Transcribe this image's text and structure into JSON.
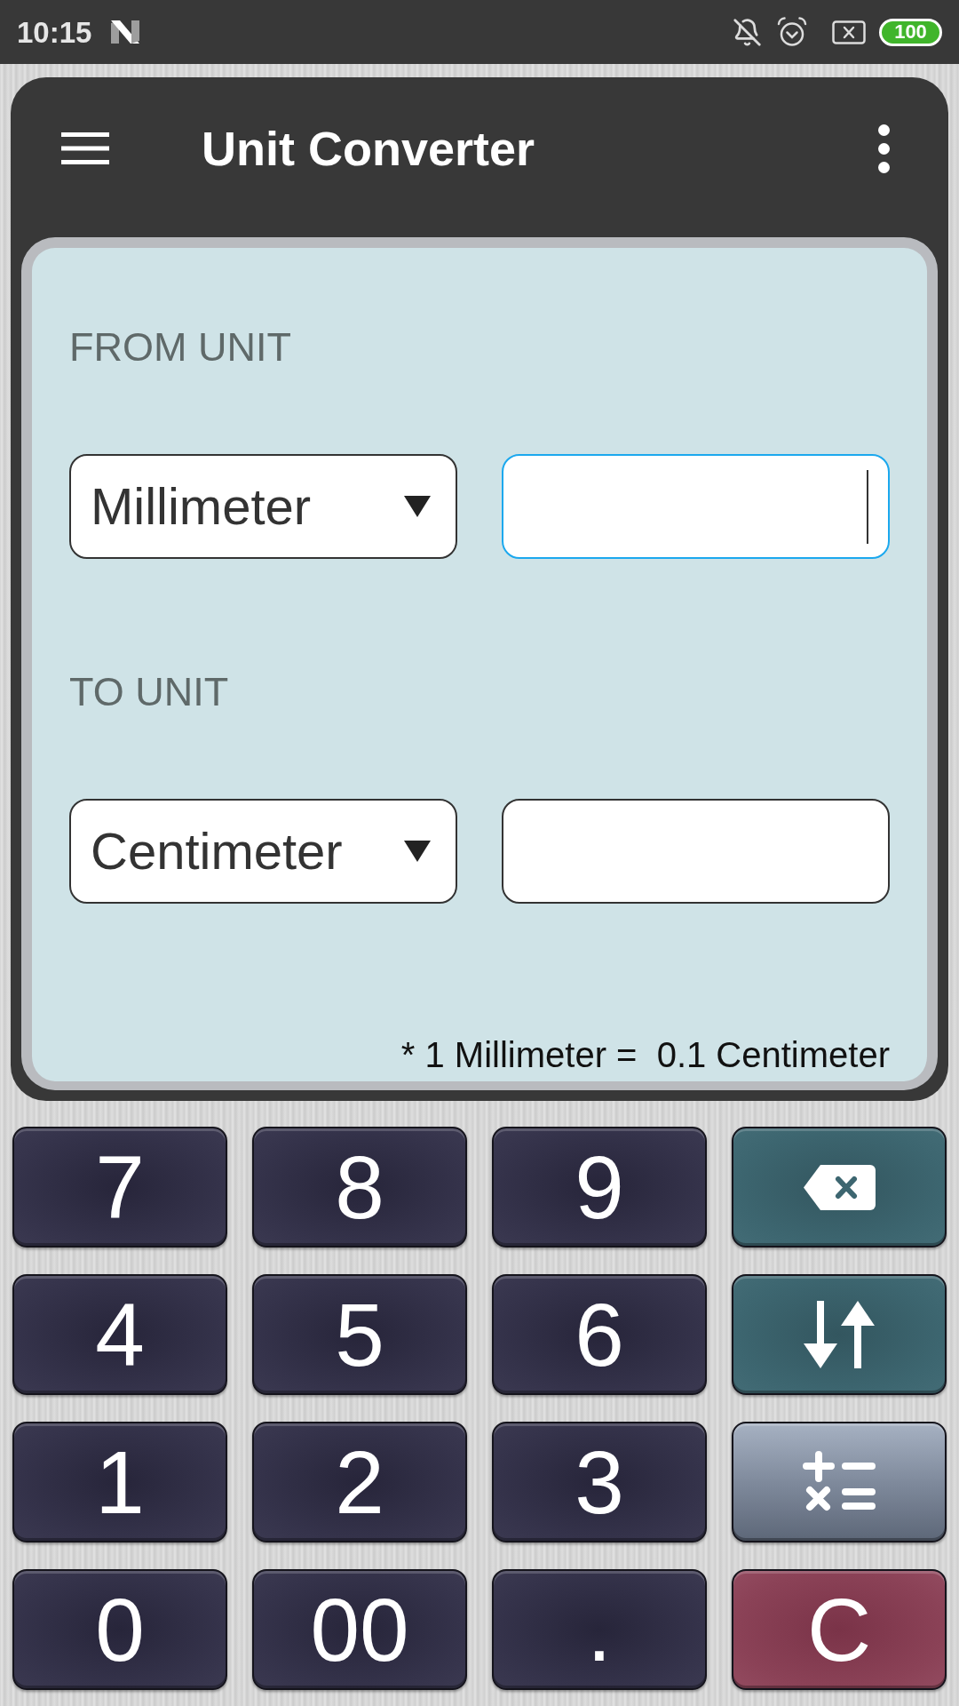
{
  "status_bar": {
    "time": "10:15",
    "battery": "100"
  },
  "app_bar": {
    "title": "Unit Converter"
  },
  "converter": {
    "sections": [
      {
        "label": "FROM UNIT",
        "unit": "Millimeter",
        "focused": true
      },
      {
        "label": "TO UNIT",
        "unit": "Centimeter",
        "focused": false
      }
    ],
    "note": "* 1 Millimeter =  0.1 Centimeter"
  },
  "keypad": [
    {
      "kind": "digit",
      "label": "7"
    },
    {
      "kind": "digit",
      "label": "8"
    },
    {
      "kind": "digit",
      "label": "9"
    },
    {
      "kind": "backspace"
    },
    {
      "kind": "digit",
      "label": "4"
    },
    {
      "kind": "digit",
      "label": "5"
    },
    {
      "kind": "digit",
      "label": "6"
    },
    {
      "kind": "swap"
    },
    {
      "kind": "digit",
      "label": "1"
    },
    {
      "kind": "digit",
      "label": "2"
    },
    {
      "kind": "digit",
      "label": "3"
    },
    {
      "kind": "calculator"
    },
    {
      "kind": "digit",
      "label": "0"
    },
    {
      "kind": "digit",
      "label": "00"
    },
    {
      "kind": "digit",
      "label": "."
    },
    {
      "kind": "clear",
      "label": "C"
    }
  ]
}
